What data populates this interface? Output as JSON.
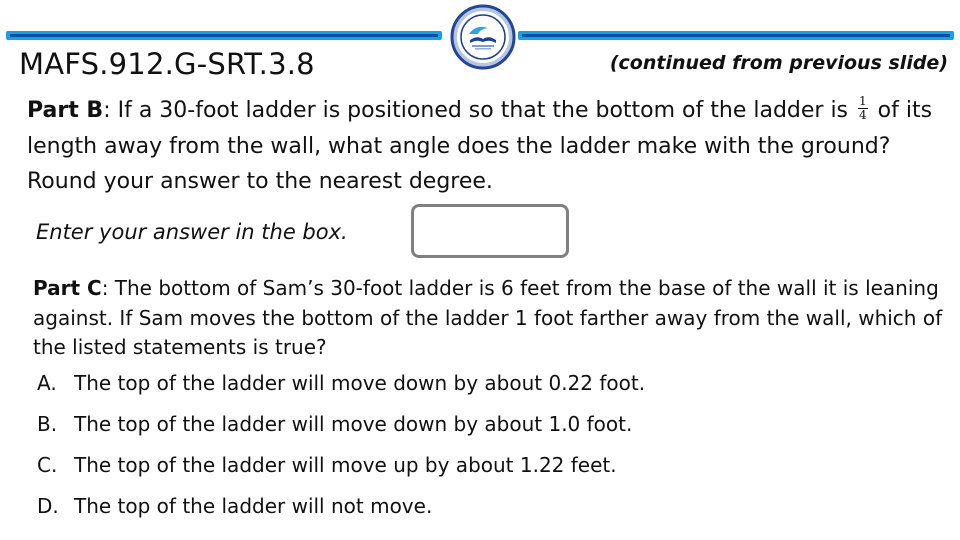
{
  "header": {
    "standard_code": "MAFS.912.G-SRT.3.8",
    "continued_note": "(continued from previous slide)",
    "logo": "school-district-seal-icon",
    "accent_colors": {
      "bar_outer": "#1a9fe0",
      "bar_inner": "#0b4fa0",
      "logo_ring": "#1f3f8f"
    }
  },
  "part_b": {
    "label": "Part B",
    "text_1": ": If a 30-foot ladder is positioned so that the bottom of the ladder is ",
    "fraction_numerator": "1",
    "fraction_denominator": "4",
    "text_2": " of its length away from the wall, what angle does the ladder make with the ground? Round your answer to the nearest degree.",
    "answer_prompt": "Enter your answer in the box.",
    "answer_value": "",
    "answer_box_border_color": "#808080"
  },
  "part_c": {
    "label": "Part C",
    "text": ": The bottom of Sam’s 30-foot ladder is 6 feet from the base of the wall it is leaning against. If Sam moves the bottom of the ladder 1 foot farther away from the wall, which of the listed statements is true?",
    "options": [
      {
        "letter": "A.",
        "text": "The top of the ladder will move down by about 0.22 foot."
      },
      {
        "letter": "B.",
        "text": "The top of the ladder will move down by about 1.0 foot."
      },
      {
        "letter": "C.",
        "text": "The top of the ladder will move up by about 1.22 feet."
      },
      {
        "letter": "D.",
        "text": "The top of the ladder will not move."
      }
    ]
  }
}
